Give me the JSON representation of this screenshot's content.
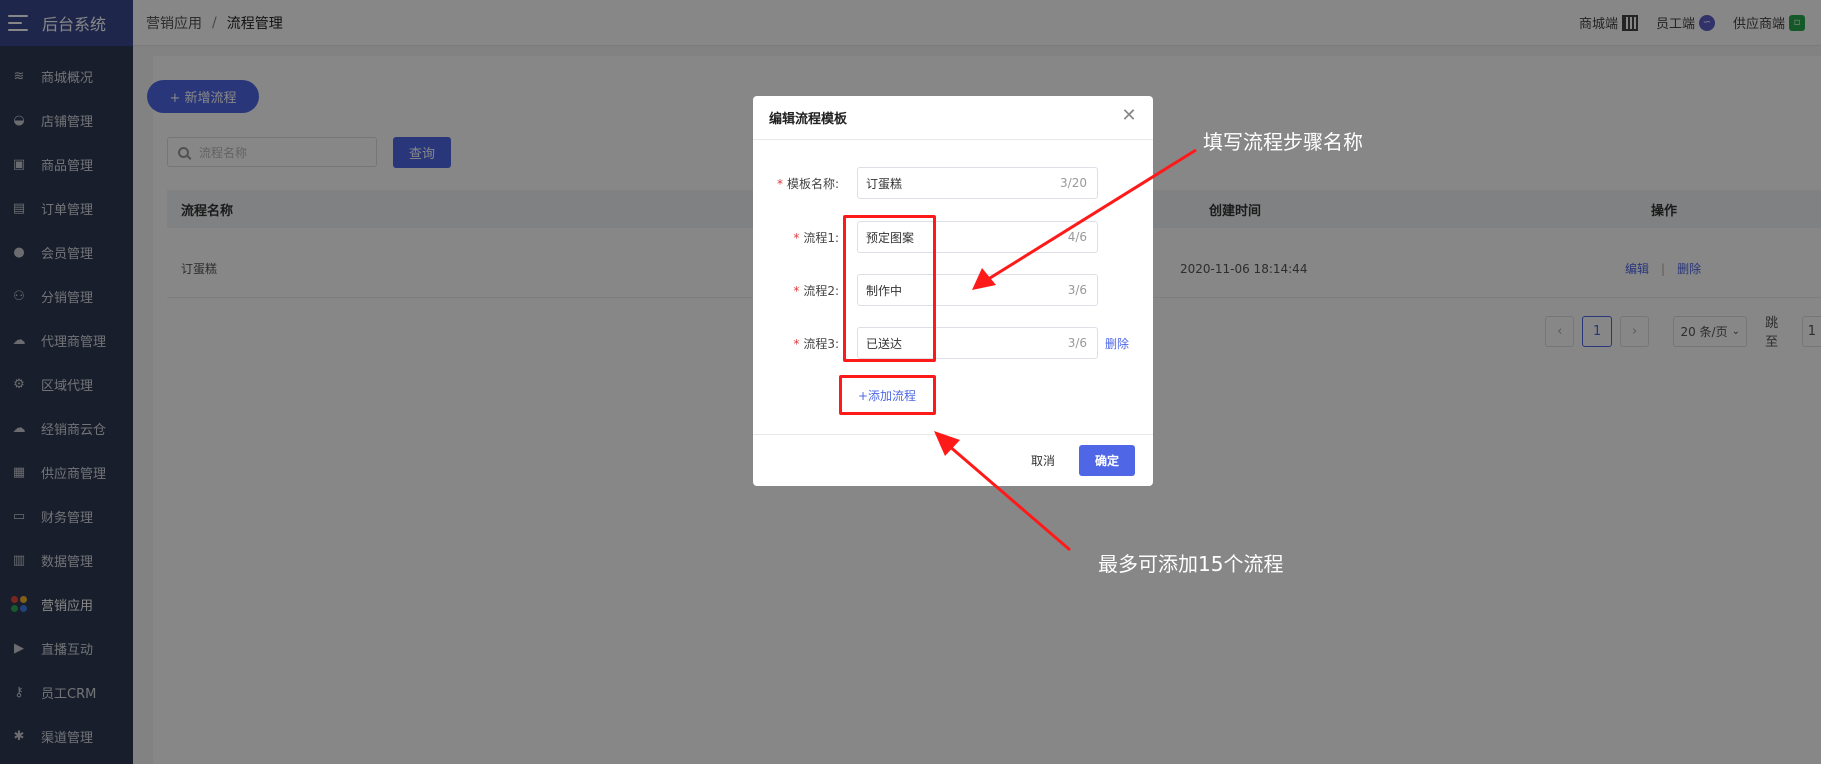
{
  "sidebar": {
    "brand": "后台系统",
    "items": [
      {
        "label": "商城概况",
        "icon": "layers-icon"
      },
      {
        "label": "店铺管理",
        "icon": "basket-icon"
      },
      {
        "label": "商品管理",
        "icon": "box-icon"
      },
      {
        "label": "订单管理",
        "icon": "document-icon"
      },
      {
        "label": "会员管理",
        "icon": "user-icon"
      },
      {
        "label": "分销管理",
        "icon": "users-icon"
      },
      {
        "label": "代理商管理",
        "icon": "handshake-icon"
      },
      {
        "label": "区域代理",
        "icon": "user-gear-icon"
      },
      {
        "label": "经销商云仓",
        "icon": "cloud-icon"
      },
      {
        "label": "供应商管理",
        "icon": "user-building-icon"
      },
      {
        "label": "财务管理",
        "icon": "wallet-icon"
      },
      {
        "label": "数据管理",
        "icon": "bar-chart-icon"
      },
      {
        "label": "营销应用",
        "icon": "apps-icon"
      },
      {
        "label": "直播互动",
        "icon": "video-icon"
      },
      {
        "label": "员工CRM",
        "icon": "user-key-icon"
      },
      {
        "label": "渠道管理",
        "icon": "gear-hand-icon"
      }
    ],
    "active_index": 12,
    "apps_icon_colors": [
      "#e8473b",
      "#f4b42f",
      "#2fa85b",
      "#3f7be8"
    ]
  },
  "header": {
    "breadcrumb_parent": "营销应用",
    "breadcrumb_sep": "/",
    "breadcrumb_current": "流程管理",
    "links": [
      {
        "label": "商城端",
        "icon": "qr-code-icon"
      },
      {
        "label": "员工端",
        "icon": "mini-program-icon"
      },
      {
        "label": "供应商端",
        "icon": "supplier-app-icon"
      }
    ]
  },
  "page": {
    "add_button": "+ 新增流程",
    "search_placeholder": "流程名称",
    "query_button": "查询",
    "table": {
      "columns": [
        "流程名称",
        "创建时间",
        "操作"
      ],
      "rows": [
        {
          "name": "订蛋糕",
          "created": "2020-11-06 18:14:44",
          "edit": "编辑",
          "delete": "删除"
        }
      ]
    },
    "pagination": {
      "prev": "‹",
      "current": "1",
      "next": "›",
      "page_size": "20 条/页",
      "jump_label": "跳至",
      "jump_value": "1"
    }
  },
  "modal": {
    "title": "编辑流程模板",
    "template_label": "模板名称:",
    "template_value": "订蛋糕",
    "template_count": "3/20",
    "flows": [
      {
        "label": "流程1:",
        "value": "预定图案",
        "count": "4/6"
      },
      {
        "label": "流程2:",
        "value": "制作中",
        "count": "3/6"
      },
      {
        "label": "流程3:",
        "value": "已送达",
        "count": "3/6",
        "delete": "删除"
      }
    ],
    "add_flow": "+添加流程",
    "cancel": "取消",
    "ok": "确定"
  },
  "annotations": {
    "top_note": "填写流程步骤名称",
    "bottom_note": "最多可添加15个流程",
    "color": "#ff1a1a"
  }
}
